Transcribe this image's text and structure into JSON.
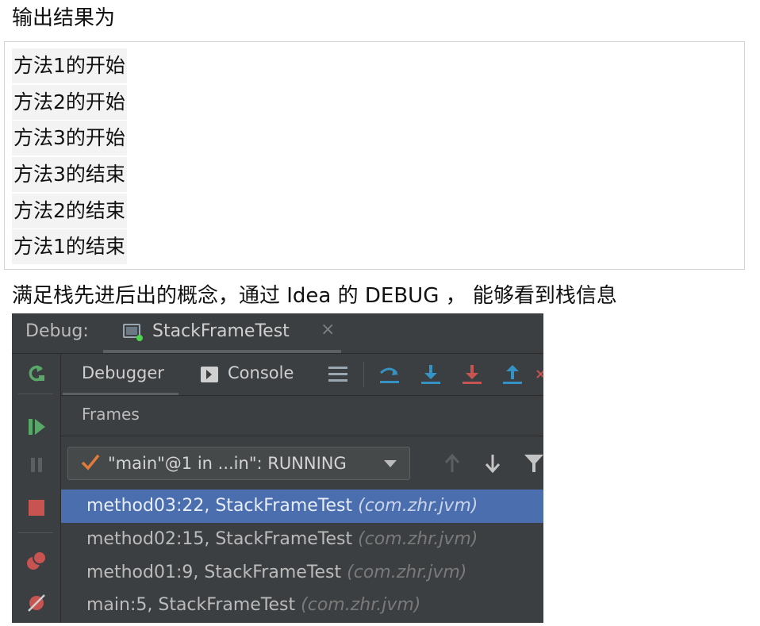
{
  "heading_output": "输出结果为",
  "output_lines": [
    "方法1的开始",
    "方法2的开始",
    "方法3的开始",
    "方法3的结束",
    "方法2的结束",
    "方法1的结束"
  ],
  "heading_debug": "满足栈先进后出的概念，通过 Idea 的 DEBUG ， 能够看到栈信息",
  "ide": {
    "debug_label": "Debug:",
    "run_tab": "StackFrameTest",
    "run_tab_close": "×",
    "tabs": {
      "debugger": "Debugger",
      "console": "Console"
    },
    "frames_title": "Frames",
    "thread_selector": "\"main\"@1 in ...in\": RUNNING",
    "frames": [
      {
        "method": "method03:22, StackFrameTest",
        "package": "(com.zhr.jvm)"
      },
      {
        "method": "method02:15, StackFrameTest",
        "package": "(com.zhr.jvm)"
      },
      {
        "method": "method01:9, StackFrameTest",
        "package": "(com.zhr.jvm)"
      },
      {
        "method": "main:5, StackFrameTest",
        "package": "(com.zhr.jvm)"
      }
    ],
    "colors": {
      "background": "#3c3f41",
      "selection": "#4b6eaf",
      "step_blue": "#3592c4",
      "step_red": "#c75450",
      "resume_green": "#59a869",
      "check_orange": "#e07b39"
    }
  }
}
